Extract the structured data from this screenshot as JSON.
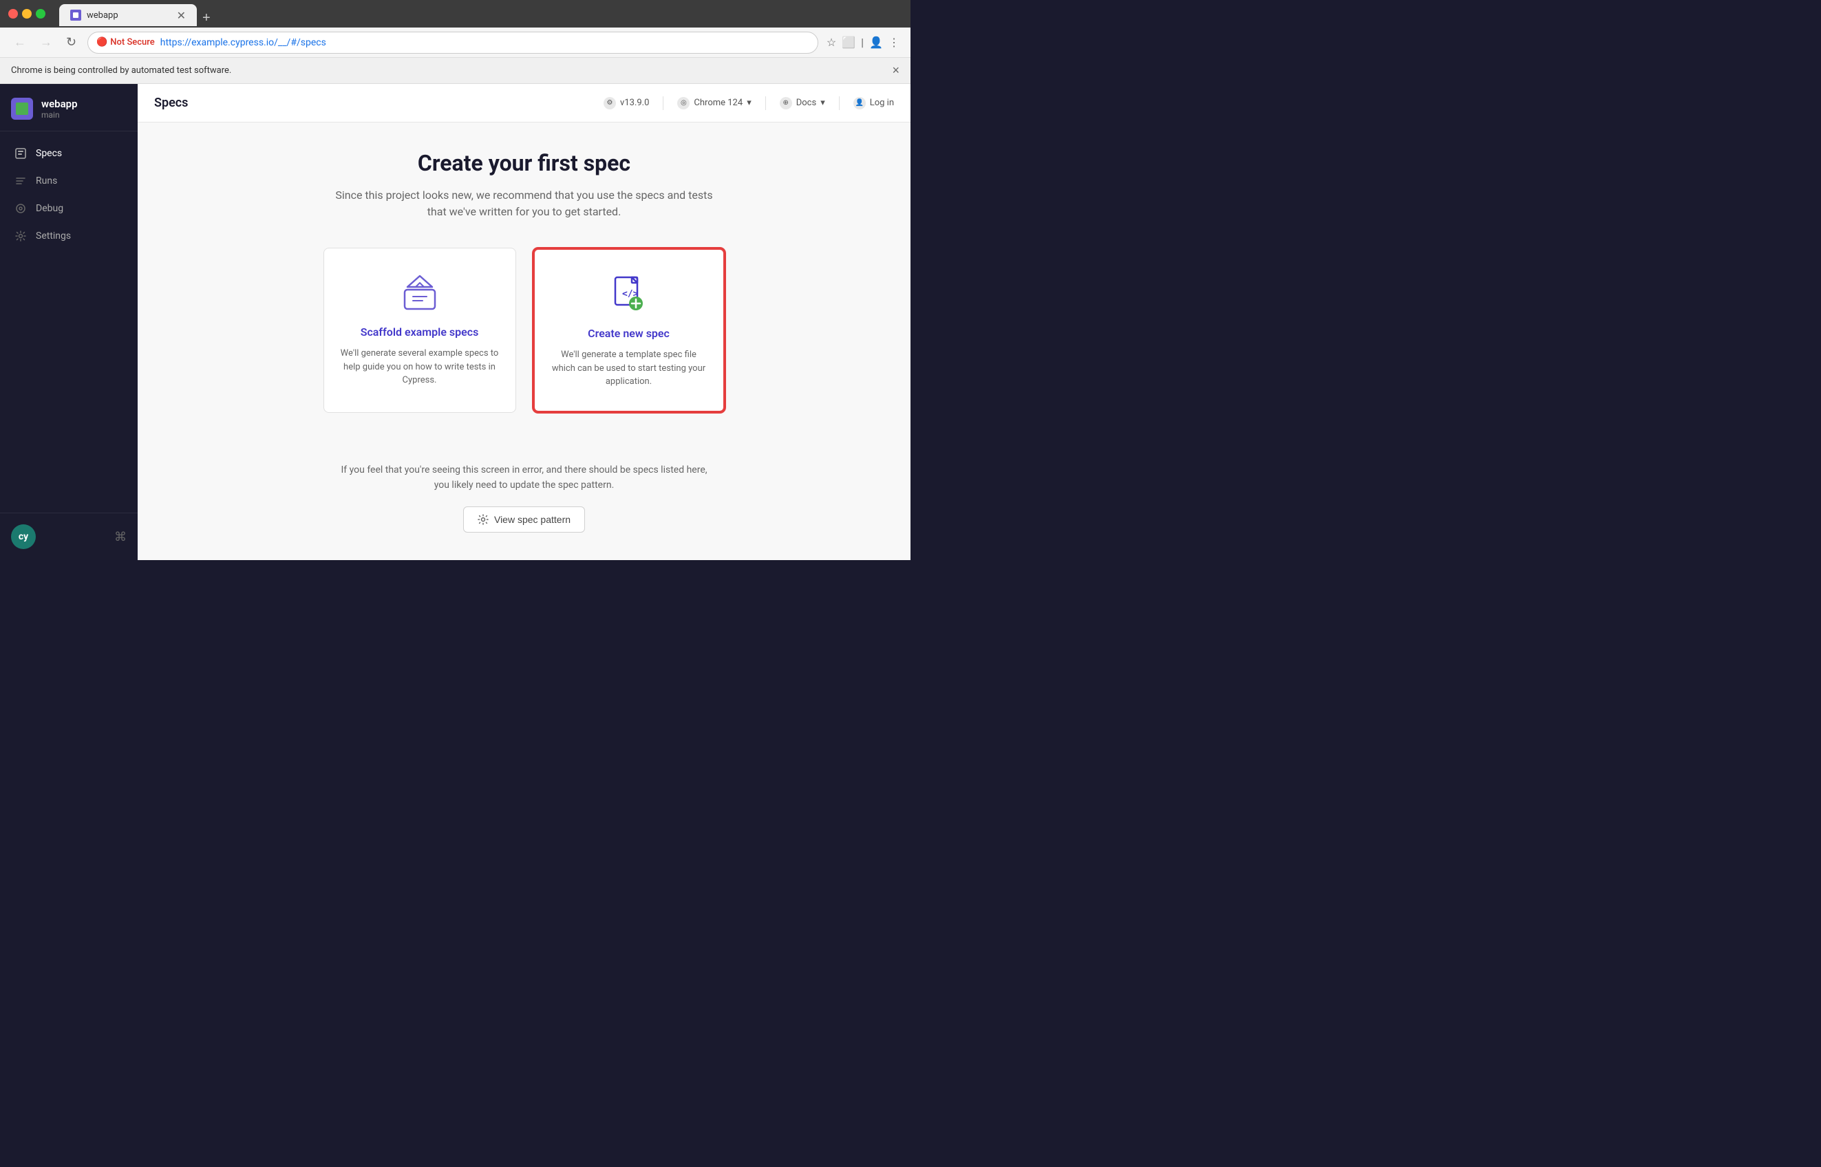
{
  "browser": {
    "tab_title": "webapp",
    "tab_plus_label": "+",
    "traffic_lights": [
      "red",
      "yellow",
      "green"
    ]
  },
  "address_bar": {
    "not_secure_label": "Not Secure",
    "url_prefix": "https://",
    "url_domain": "example.cypress.io/",
    "url_path": "__/#/specs",
    "back_btn": "←",
    "forward_btn": "→",
    "refresh_btn": "↺"
  },
  "automation_banner": {
    "message": "Chrome is being controlled by automated test software.",
    "close_label": "×"
  },
  "sidebar": {
    "app_name": "webapp",
    "app_branch": "main",
    "nav_items": [
      {
        "id": "specs",
        "label": "Specs",
        "active": true
      },
      {
        "id": "runs",
        "label": "Runs",
        "active": false
      },
      {
        "id": "debug",
        "label": "Debug",
        "active": false
      },
      {
        "id": "settings",
        "label": "Settings",
        "active": false
      }
    ],
    "cy_logo": "cy"
  },
  "header": {
    "title": "Specs",
    "version": "v13.9.0",
    "browser": "Chrome 124",
    "docs_label": "Docs",
    "login_label": "Log in"
  },
  "page": {
    "heading": "Create your first spec",
    "subheading": "Since this project looks new, we recommend that you use the specs and tests that we've written for you to get started.",
    "scaffold_card": {
      "title": "Scaffold example specs",
      "description": "We'll generate several example specs to help guide you on how to write tests in Cypress."
    },
    "new_spec_card": {
      "title": "Create new spec",
      "description": "We'll generate a template spec file which can be used to start testing your application."
    },
    "error_text_line1": "If you feel that you're seeing this screen in error, and there should be specs listed here,",
    "error_text_line2": "you likely need to update the spec pattern.",
    "view_pattern_btn": "View spec pattern"
  }
}
